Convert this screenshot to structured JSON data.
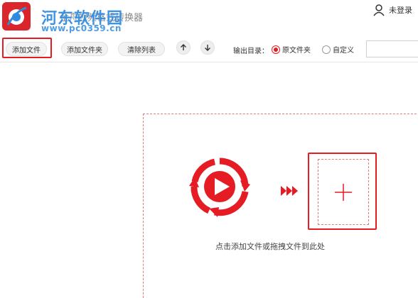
{
  "window": {
    "title": "金舟视频格式转换器",
    "watermark_text": "河东软件园",
    "watermark_url": "www.pc0359.cn",
    "user": {
      "login_label": "未登录",
      "icon": "user-icon"
    }
  },
  "toolbar": {
    "add_file_label": "添加文件",
    "add_folder_label": "添加文件夹",
    "clear_list_label": "清除列表",
    "move_up_icon": "arrow-up-icon",
    "move_down_icon": "arrow-down-icon",
    "output_dir_label": "输出目录：",
    "output_options": [
      {
        "label": "原文件夹",
        "checked": true
      },
      {
        "label": "自定义",
        "checked": false
      }
    ],
    "output_path_value": ""
  },
  "dropzone": {
    "hint": "点击添加文件或拖拽文件到此处",
    "add_icon": "plus-icon",
    "logo_icon": "video-play-icon",
    "arrow_icon": "triple-arrow-icon"
  },
  "colors": {
    "accent": "#e51c23",
    "dash": "#e07b7b",
    "watermark": "#2f8be0"
  }
}
